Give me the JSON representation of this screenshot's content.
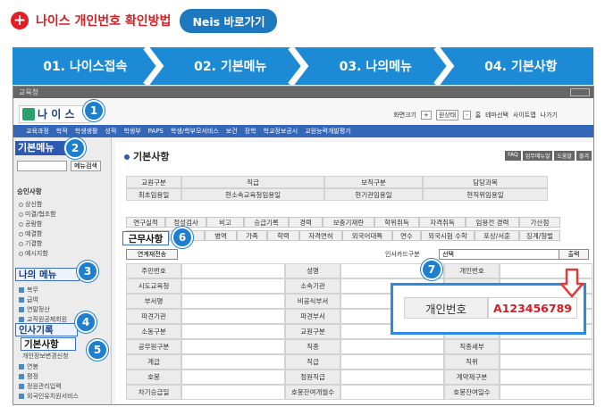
{
  "header": {
    "title": "나이스 개인번호 확인방법",
    "neis_button": "Neis 바로가기"
  },
  "steps": [
    "01. 나이스접속",
    "02. 기본메뉴",
    "03. 나의메뉴",
    "04. 기본사항"
  ],
  "screen": {
    "window_title": "교육청",
    "logo": "나 이 스",
    "top_tools": [
      "화면크기",
      "+",
      "원상태",
      "-",
      "홈",
      "테마선택",
      "사이트맵",
      "나가기"
    ],
    "menubar": [
      "교육과정",
      "학적",
      "학생생활",
      "성적",
      "학생부",
      "PAPS",
      "학생/학부모서비스",
      "보건",
      "장학",
      "학교정보공시",
      "교원능력개발평가"
    ],
    "left": {
      "basic_menu": "기본메뉴",
      "menu_search": "메뉴검색",
      "approval": "승인사항",
      "approval_items": [
        "상신함",
        "미결/협조함",
        "공람함",
        "예결함",
        "기결함",
        "예시지함"
      ],
      "my_menu": "나의 메뉴",
      "folders": [
        "복무",
        "급여",
        "연말정산",
        "교직원공제회원"
      ],
      "personnel": "인사기록",
      "basic_info": "기본사항",
      "sub_item": "개인정보변경신청",
      "bottom_folders": [
        "연봉",
        "평정",
        "정원관리입력",
        "외국인유치원서비스"
      ]
    },
    "content": {
      "title": "기본사항",
      "top_buttons": [
        "FAQ",
        "업무매뉴얼",
        "도움말",
        "즐겨"
      ],
      "grid1": [
        [
          "교원구분",
          "직급",
          "보직구분",
          "담당과목"
        ],
        [
          "최초임용일",
          "현소속교육청임용일",
          "현기관임용일",
          "현직위임용일"
        ]
      ],
      "tabs_row1": [
        "연구실적",
        "정성검사",
        "비고",
        "승급기록",
        "경력",
        "보충기재란",
        "학위취득",
        "자격취득",
        "임용전 경력",
        "가산점"
      ],
      "tabs_row2": [
        "근무사항",
        "신상",
        "병역",
        "가족",
        "학력",
        "자격면허",
        "외국어대특",
        "연수",
        "외국시험 수학",
        "포상/서훈",
        "징계/형벌"
      ],
      "link_btn": "연계재전송",
      "card_label": "인사카드구분",
      "select_value": "선택",
      "print_btn": "출력",
      "grid2": [
        [
          "주민번호",
          "",
          "성명",
          "",
          "개인번호",
          ""
        ],
        [
          "시도교육청",
          "",
          "소속기관",
          "",
          "",
          ""
        ],
        [
          "부서명",
          "",
          "비공식부서",
          "",
          "",
          ""
        ],
        [
          "파견기관",
          "",
          "파견부서",
          "",
          "",
          ""
        ],
        [
          "소동구분",
          "",
          "교원구분",
          "",
          "보직구분",
          ""
        ],
        [
          "공무원구분",
          "",
          "직종",
          "",
          "직종세부",
          ""
        ],
        [
          "계급",
          "",
          "직급",
          "",
          "직위",
          ""
        ],
        [
          "호봉",
          "",
          "정원직급",
          "",
          "계약제구분",
          ""
        ],
        [
          "차기승급일",
          "",
          "호봉잔여개월수",
          "",
          "호봉잔여일수",
          ""
        ]
      ]
    },
    "popup": {
      "label": "개인번호",
      "value": "A123456789"
    },
    "badges": [
      "1",
      "2",
      "3",
      "4",
      "5",
      "6",
      "7"
    ]
  }
}
